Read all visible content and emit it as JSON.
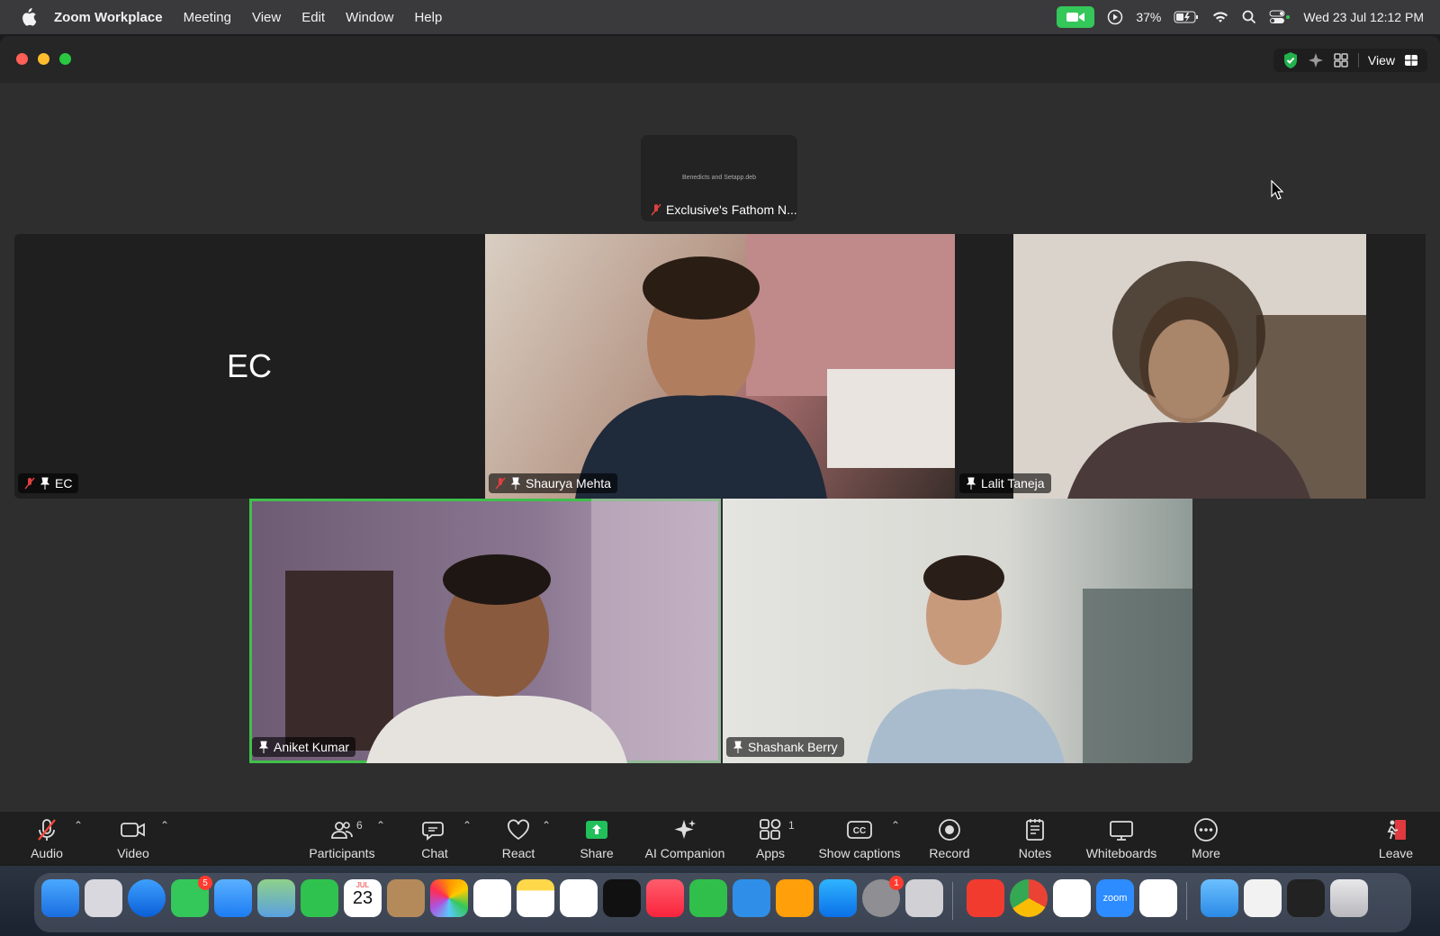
{
  "menubar": {
    "app_name": "Zoom Workplace",
    "menus": [
      "Meeting",
      "View",
      "Edit",
      "Window",
      "Help"
    ],
    "battery": "37%",
    "datetime": "Wed 23 Jul  12:12 PM"
  },
  "window": {
    "view_label": "View"
  },
  "thumbnail": {
    "name": "Exclusive's Fathom N...",
    "small_text": "Benedicts and Setapp.deb"
  },
  "participants": [
    {
      "name": "EC",
      "initials": "EC",
      "muted": true
    },
    {
      "name": "Shaurya Mehta",
      "muted": true
    },
    {
      "name": "Lalit Taneja",
      "muted": false
    },
    {
      "name": "Aniket Kumar",
      "muted": false,
      "active_speaker": true
    },
    {
      "name": "Shashank Berry",
      "muted": false
    }
  ],
  "toolbar": {
    "audio": "Audio",
    "video": "Video",
    "participants": "Participants",
    "participants_count": "6",
    "chat": "Chat",
    "react": "React",
    "share": "Share",
    "ai_companion": "AI Companion",
    "apps": "Apps",
    "apps_count": "1",
    "show_captions": "Show captions",
    "record": "Record",
    "notes": "Notes",
    "whiteboards": "Whiteboards",
    "more": "More",
    "leave": "Leave"
  },
  "dock": {
    "calendar_month": "JUL",
    "calendar_day": "23",
    "messages_badge": "5",
    "settings_badge": "1",
    "zoom_label": "zoom"
  },
  "colors": {
    "active_speaker": "#3fbf4b",
    "share_green": "#21c05a",
    "zoom_camera_indicator": "#34c759"
  }
}
